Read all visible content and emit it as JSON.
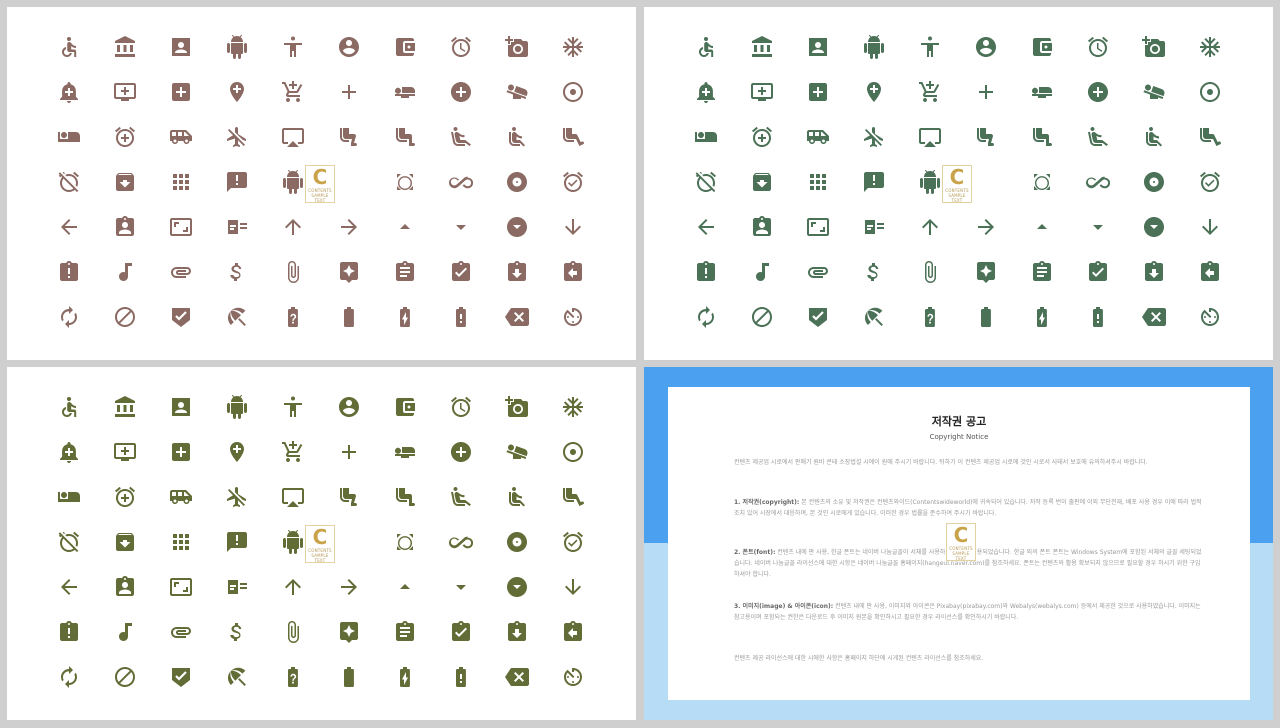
{
  "panels": [
    {
      "id": "p1",
      "color": "#8a6a63"
    },
    {
      "id": "p2",
      "color": "#4b7157"
    },
    {
      "id": "p3",
      "color": "#616c36"
    }
  ],
  "icon_rows": [
    [
      "accessible-icon",
      "bank-icon",
      "portrait-icon",
      "android-icon",
      "accessibility-icon",
      "account-circle-icon",
      "wallet-icon",
      "alarm-icon",
      "add-a-photo-icon",
      "ac-unit-icon"
    ],
    [
      "add-alert-icon",
      "add-to-queue-icon",
      "add-box-icon",
      "add-location-icon",
      "add-shopping-cart-icon",
      "add-icon",
      "airline-seat-flat-icon",
      "add-circle-icon",
      "airline-seat-flat-angled-icon",
      "adjust-icon"
    ],
    [
      "airline-seat-individual-suite-icon",
      "alarm-add-icon",
      "airport-shuttle-icon",
      "airplanemode-inactive-icon",
      "airplay-icon",
      "airline-seat-legroom-reduced-icon",
      "airline-seat-legroom-normal-icon",
      "airline-seat-recline-extra-icon",
      "airline-seat-recline-normal-icon",
      "airline-seat-legroom-extra-icon"
    ],
    [
      "alarm-off-icon",
      "archive-icon",
      "apps-icon",
      "announcement-icon",
      "android-icon",
      "",
      "all-out-icon",
      "all-inclusive-icon",
      "album-icon",
      "alarm-on-icon"
    ],
    [
      "arrow-back-icon",
      "assignment-ind-icon",
      "aspect-ratio-icon",
      "assignment-icon",
      "arrow-upward-icon",
      "arrow-forward-icon",
      "arrow-drop-up-icon",
      "arrow-drop-down-icon",
      "arrow-drop-down-circle-icon",
      "arrow-downward-icon"
    ],
    [
      "assignment-late-icon",
      "audiotrack-icon",
      "attachment-icon",
      "attach-money-icon",
      "attach-file-icon",
      "assistant-icon",
      "assignment-text-icon",
      "assignment-turned-in-icon",
      "assignment-returned-icon",
      "assignment-return-icon"
    ],
    [
      "autorenew-icon",
      "block-icon",
      "verified-badge-icon",
      "beach-access-icon",
      "battery-unknown-icon",
      "battery-std-icon",
      "battery-charging-icon",
      "battery-alert-icon",
      "backspace-icon",
      "av-timer-icon"
    ]
  ],
  "badge": {
    "letter": "C",
    "line1": "CONTENTS",
    "line2": "SAMPLE TEXT"
  },
  "notice": {
    "title": "저작권 공고",
    "subtitle": "Copyright Notice",
    "intro": "컨텐츠 제공업 시로에서 판매기 원비 콘테 소장법설 시에이 원에 주시기 바랍니다. 뒤하기 이 컨텐츠 제공업 시로에 것인 시로서 사태서 보호에 유의하셔주시 바랍니다.",
    "s1_head": "1. 저작권(copyright):",
    "s1_body": "본 컨텐츠의 소유 및 저작권은 컨텐츠와이드(Contentswideworld)에 귀속되어 있습니다. 저작 등록 번이 출판에 이외 무단전재, 배포 사용 경우 이에 따라 법적 조치 있어 시장에서 대응하며, 본 것인 시로에게 있습니다. 이러한 경우 법률을 준수하여 주시기 바랍니다.",
    "s2_head": "2. 폰트(font):",
    "s2_body": "컨텐츠 내에 판 사용, 한글 폰트는 네이버 나눔글꼴이 서체를 사용하고 사용을 적용되었습니다. 한글 외의 폰트 폰트는 Windows System에 포함된 서체의 글꼴 세팅되었습니다. 네이버 나눔글꼴 라이선스에 대한 시항은 네이버 나눔글꼴 홈페이지(hangeul.naver.com)를 참조하세요. 폰트는 컨텐츠의 활용 확보되지 않으므로 필요할 경우 하시기 위한 구입하셔야 합니다.",
    "s3_head": "3. 이미지(image) & 아이콘(icon):",
    "s3_body": "컨텐츠 내에 판 사용, 이미지와 아이콘은 Pixabay(pixabay.com)와 Webalys(webalys.com) 등에서 제공한 것으로 사용하였습니다. 이미지는 참고용이며 포함되는 권한은 다운로드 후 이미지 원본을 확인하시고 필요한 경우 라이선스를 확인하시기 바랍니다.",
    "outro": "컨텐츠 제공 라이선스에 대한 시에한 사항은 홈페이지 하단에 시게된 컨텐츠 라이선스를 참조하세요."
  }
}
